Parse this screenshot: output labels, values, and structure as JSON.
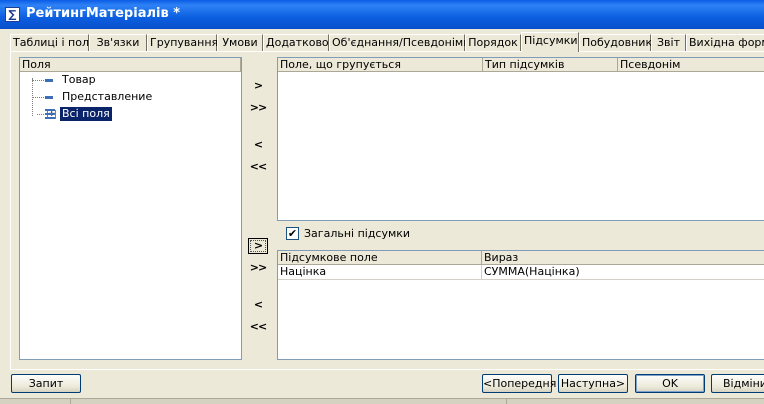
{
  "window": {
    "title": "РейтингМатеріалів *",
    "icon": "sigma-icon",
    "icon_glyph": "∑"
  },
  "tabs": [
    {
      "label": "Таблиці і поля",
      "active": false
    },
    {
      "label": "Зв'язки",
      "active": false
    },
    {
      "label": "Групування",
      "active": false
    },
    {
      "label": "Умови",
      "active": false
    },
    {
      "label": "Додатково",
      "active": false
    },
    {
      "label": "Об'єднання/Псевдоніми",
      "active": false
    },
    {
      "label": "Порядок",
      "active": false
    },
    {
      "label": "Підсумки",
      "active": true
    },
    {
      "label": "Побудовник",
      "active": false
    },
    {
      "label": "Звіт",
      "active": false
    },
    {
      "label": "Вихідна форма",
      "active": false
    }
  ],
  "fields_tree": {
    "header": "Поля",
    "items": [
      {
        "label": "Товар",
        "icon": "field-icon",
        "selected": false
      },
      {
        "label": "Представление",
        "icon": "field-icon",
        "selected": false
      },
      {
        "label": "Всі поля",
        "icon": "table-icon",
        "selected": true,
        "expander": "+"
      }
    ]
  },
  "move_buttons_top": [
    {
      "label": ">",
      "name": "add-group-field-button"
    },
    {
      "label": ">>",
      "name": "add-all-group-fields-button"
    },
    {
      "label": "<",
      "name": "remove-group-field-button"
    },
    {
      "label": "<<",
      "name": "remove-all-group-fields-button"
    }
  ],
  "move_buttons_bottom": [
    {
      "label": ">",
      "name": "add-total-field-button"
    },
    {
      "label": ">>",
      "name": "add-all-total-fields-button"
    },
    {
      "label": "<",
      "name": "remove-total-field-button"
    },
    {
      "label": "<<",
      "name": "remove-all-total-fields-button"
    }
  ],
  "group_grid": {
    "columns": [
      "Поле, що групується",
      "Тип підсумків",
      "Псевдонім"
    ]
  },
  "overall_totals": {
    "checked": true,
    "check_glyph": "✔",
    "label": "Загальні підсумки"
  },
  "totals_grid": {
    "columns": [
      "Підсумкове поле",
      "Вираз"
    ],
    "rows": [
      [
        "Націнка",
        "СУММА(Націнка)"
      ]
    ]
  },
  "footer": {
    "query_label": "Запит",
    "prev_label": "<Попередня",
    "next_label": "Наступна>",
    "ok_label": "OK",
    "cancel_label": "Відмінити"
  }
}
